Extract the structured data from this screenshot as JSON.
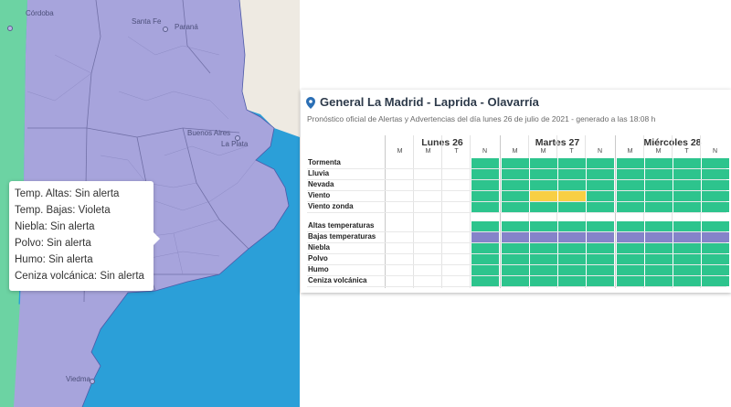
{
  "map": {
    "cities": [
      "Córdoba",
      "Santa Fe",
      "Paraná",
      "Buenos Aires",
      "La Plata",
      "Viedma"
    ]
  },
  "tooltip": {
    "lines": [
      "Temp. Altas: Sin alerta",
      "Temp. Bajas: Violeta",
      "Niebla: Sin alerta",
      "Polvo: Sin alerta",
      "Humo: Sin alerta",
      "Ceniza volcánica: Sin alerta"
    ]
  },
  "panel": {
    "title": "General La Madrid - Laprida - Olavarría",
    "subtitle": "Pronóstico oficial de Alertas y Advertencias del día lunes 26 de julio de 2021 - generado a las 18:08 h",
    "pin_icon": "map-pin-icon",
    "days": [
      "Lunes 26",
      "Martes 27",
      "Miércoles 28"
    ],
    "slots": [
      "M",
      "M",
      "T",
      "N"
    ],
    "colors": {
      "green": "#2dc48d",
      "yellow": "#f8cf44",
      "violet": "#8583c9"
    },
    "rows_group1": [
      {
        "label": "Tormenta",
        "cells": [
          "",
          "",
          "",
          "green",
          "green",
          "green",
          "green",
          "green",
          "green",
          "green",
          "green",
          "green"
        ]
      },
      {
        "label": "Lluvia",
        "cells": [
          "",
          "",
          "",
          "green",
          "green",
          "green",
          "green",
          "green",
          "green",
          "green",
          "green",
          "green"
        ]
      },
      {
        "label": "Nevada",
        "cells": [
          "",
          "",
          "",
          "green",
          "green",
          "green",
          "green",
          "green",
          "green",
          "green",
          "green",
          "green"
        ]
      },
      {
        "label": "Viento",
        "cells": [
          "",
          "",
          "",
          "green",
          "green",
          "yellow",
          "yellow",
          "green",
          "green",
          "green",
          "green",
          "green"
        ]
      },
      {
        "label": "Viento zonda",
        "cells": [
          "",
          "",
          "",
          "green",
          "green",
          "green",
          "green",
          "green",
          "green",
          "green",
          "green",
          "green"
        ]
      }
    ],
    "rows_group2": [
      {
        "label": "Altas temperaturas",
        "cells": [
          "",
          "",
          "",
          "green",
          "green",
          "green",
          "green",
          "green",
          "green",
          "green",
          "green",
          "green"
        ]
      },
      {
        "label": "Bajas temperaturas",
        "cells": [
          "",
          "",
          "",
          "violet",
          "violet",
          "violet",
          "violet",
          "violet",
          "violet",
          "violet",
          "violet",
          "violet"
        ]
      },
      {
        "label": "Niebla",
        "cells": [
          "",
          "",
          "",
          "green",
          "green",
          "green",
          "green",
          "green",
          "green",
          "green",
          "green",
          "green"
        ]
      },
      {
        "label": "Polvo",
        "cells": [
          "",
          "",
          "",
          "green",
          "green",
          "green",
          "green",
          "green",
          "green",
          "green",
          "green",
          "green"
        ]
      },
      {
        "label": "Humo",
        "cells": [
          "",
          "",
          "",
          "green",
          "green",
          "green",
          "green",
          "green",
          "green",
          "green",
          "green",
          "green"
        ]
      },
      {
        "label": "Ceniza volcánica",
        "cells": [
          "",
          "",
          "",
          "green",
          "green",
          "green",
          "green",
          "green",
          "green",
          "green",
          "green",
          "green"
        ]
      }
    ]
  }
}
